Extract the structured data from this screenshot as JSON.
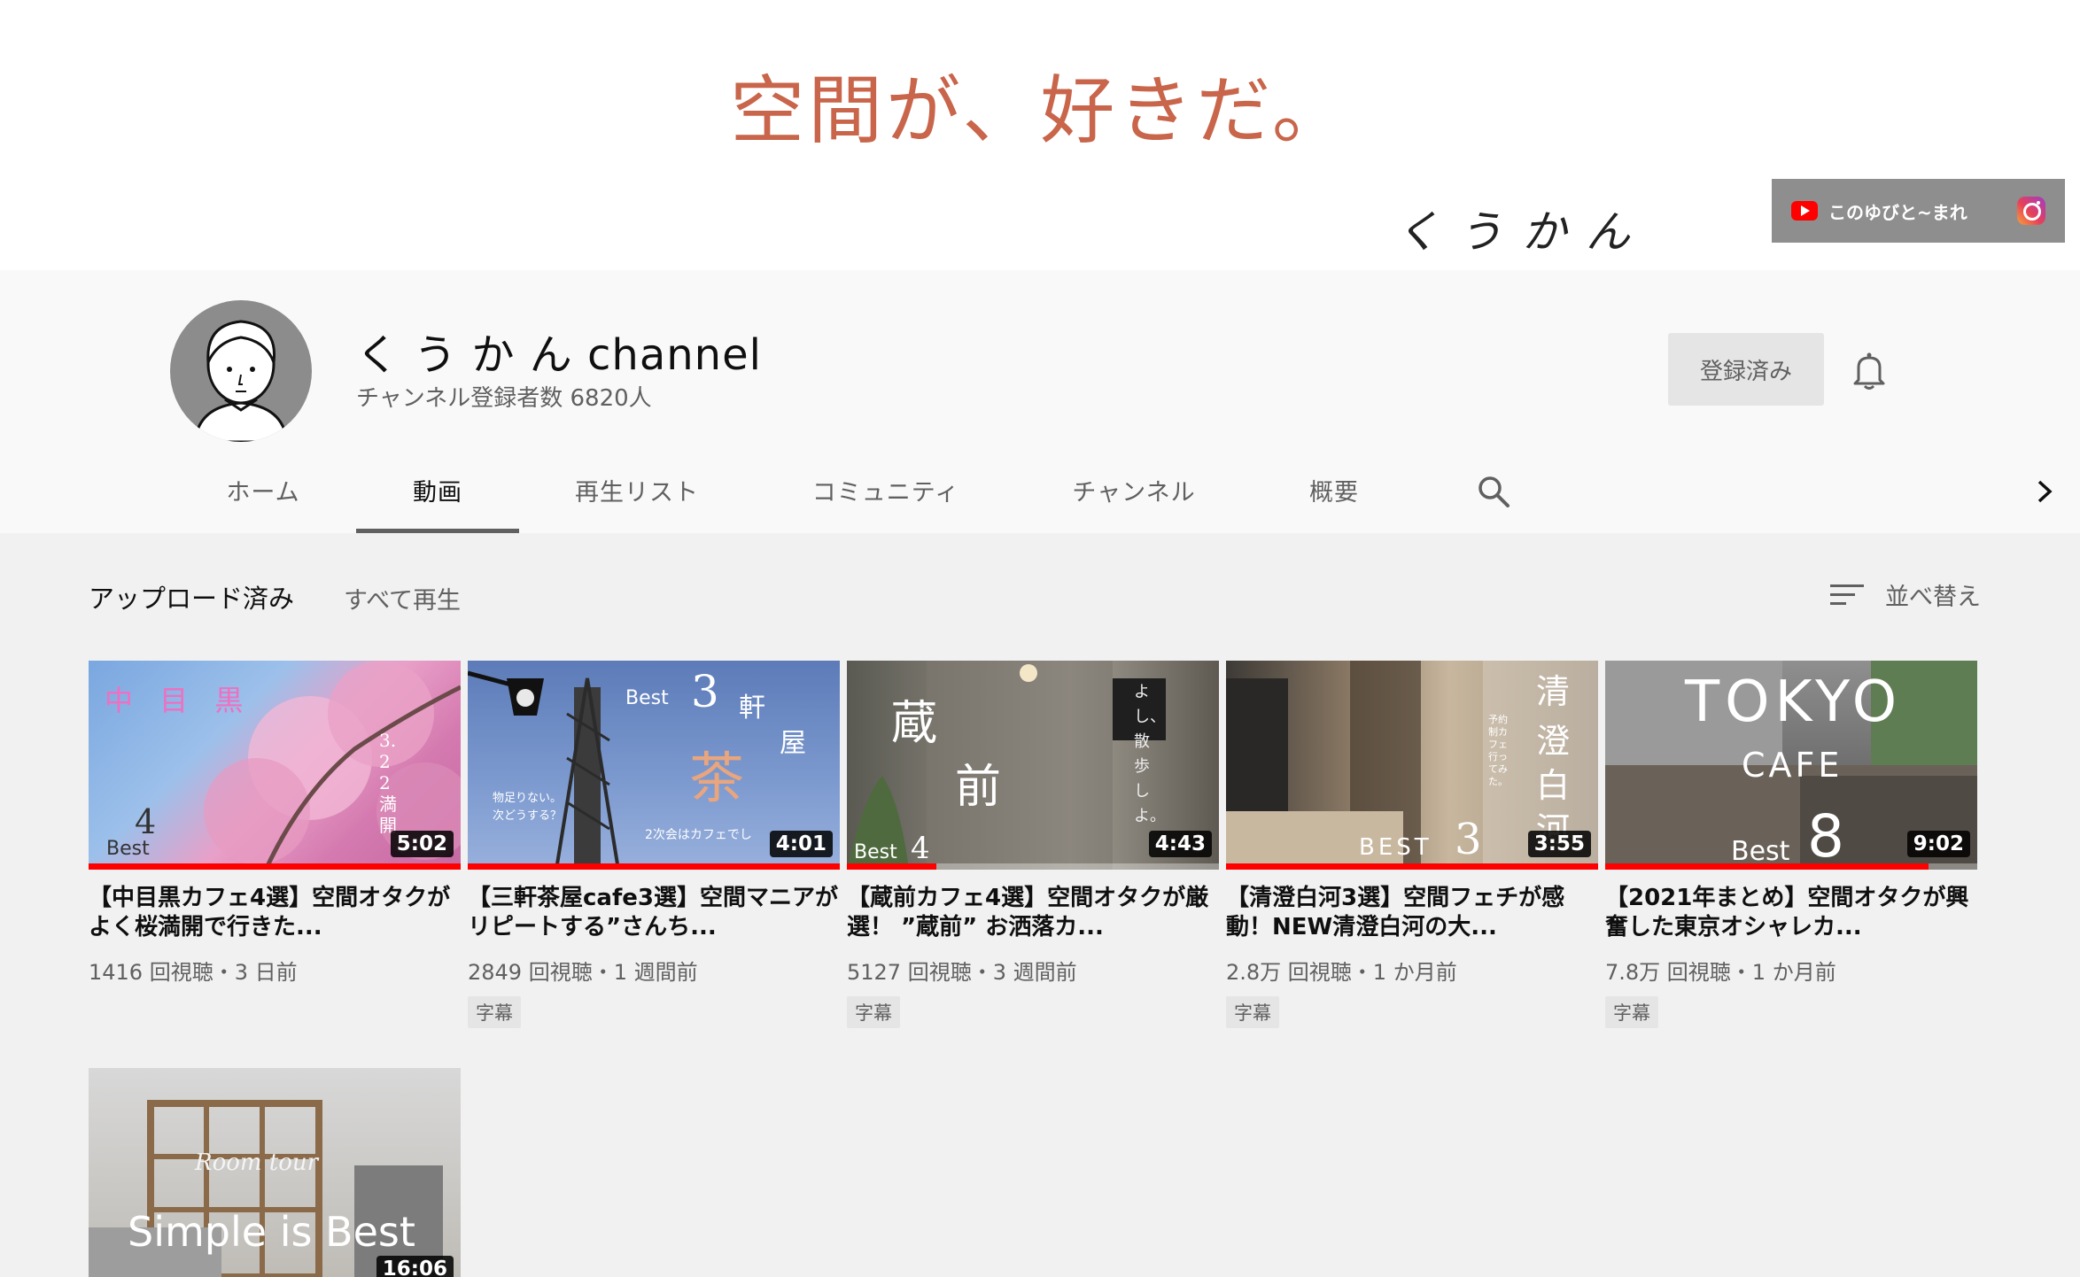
{
  "banner": {
    "title": "空間が、好きだ。",
    "signature": "くうかん",
    "link_label": "このゆびと~まれ"
  },
  "channel": {
    "name": "く う か ん channel",
    "subscribers": "チャンネル登録者数 6820人",
    "subscribed_label": "登録済み"
  },
  "tabs": [
    "ホーム",
    "動画",
    "再生リスト",
    "コミュニティ",
    "チャンネル",
    "概要"
  ],
  "active_tab": "動画",
  "section": {
    "title": "アップロード済み",
    "play_all": "すべて再生",
    "sort_label": "並べ替え"
  },
  "videos": [
    {
      "title": "【中目黒カフェ4選】空間オタクがよく桜満開で行きた...",
      "meta": "1416 回視聴・3 日前",
      "duration": "5:02",
      "badge": "",
      "progress": 1.0,
      "thumb_text": [
        "中 目 黒",
        "4",
        "Best",
        "3.22満開"
      ]
    },
    {
      "title": "【三軒茶屋cafe3選】空間マニアがリピートする”さんち...",
      "meta": "2849 回視聴・1 週間前",
      "duration": "4:01",
      "badge": "字幕",
      "progress": 1.0,
      "thumb_text": [
        "Best",
        "3",
        "軒",
        "屋",
        "茶",
        "物足りない。",
        "次どうする？",
        "2次会はカフェでし"
      ]
    },
    {
      "title": "【蔵前カフェ4選】空間オタクが厳選！ ”蔵前” お洒落カ...",
      "meta": "5127 回視聴・3 週間前",
      "duration": "4:43",
      "badge": "字幕",
      "progress": 0.24,
      "thumb_text": [
        "蔵",
        "前",
        "Best",
        "4",
        "よし、散歩しよ。"
      ]
    },
    {
      "title": "【清澄白河3選】空間フェチが感動！NEW清澄白河の大...",
      "meta": "2.8万 回視聴・1 か月前",
      "duration": "3:55",
      "badge": "字幕",
      "progress": 1.0,
      "thumb_text": [
        "清",
        "澄",
        "白",
        "河",
        "BEST",
        "3",
        "予約制カフェ 行ってみた。"
      ]
    },
    {
      "title": "【2021年まとめ】空間オタクが興奮した東京オシャレカ...",
      "meta": "7.8万 回視聴・1 か月前",
      "duration": "9:02",
      "badge": "字幕",
      "progress": 0.87,
      "thumb_text": [
        "TOKYO",
        "CAFE",
        "Best",
        "8"
      ]
    },
    {
      "title": "",
      "meta": "",
      "duration": "16:06",
      "badge": "",
      "progress": 0,
      "thumb_text": [
        "Simple is Best",
        "Room tour"
      ]
    }
  ],
  "icons": [
    "youtube-icon",
    "instagram-icon",
    "bell-icon",
    "search-icon",
    "chevron-right-icon",
    "sort-icon"
  ],
  "colors": {
    "banner_title": "#c8654a",
    "progress": "#ff0000",
    "page_bg": "#f1f1f1"
  }
}
